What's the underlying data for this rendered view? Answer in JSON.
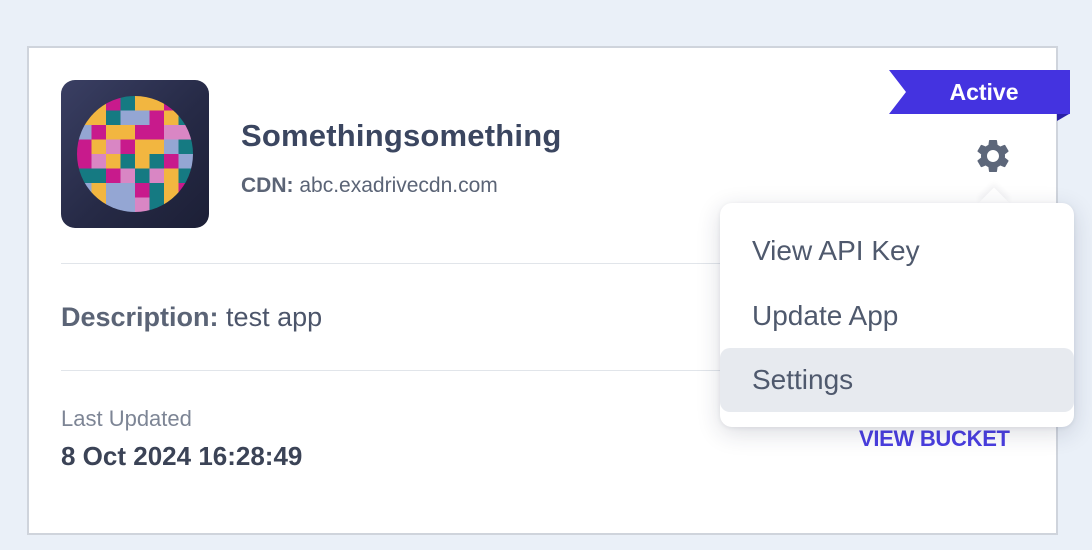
{
  "card": {
    "status_badge": "Active",
    "app_name": "Somethingsomething",
    "cdn_label": "CDN:",
    "cdn_value": "abc.exadrivecdn.com",
    "description_label": "Description:",
    "description_value": "test app",
    "last_updated_label": "Last Updated",
    "last_updated_value": "8 Oct 2024 16:28:49",
    "view_bucket_label": "VIEW BUCKET"
  },
  "menu": {
    "items": [
      {
        "label": "View API Key"
      },
      {
        "label": "Update App"
      },
      {
        "label": "Settings",
        "highlighted": true
      }
    ]
  },
  "icons": {
    "settings": "gear-icon",
    "app": "app-mosaic-icon"
  },
  "colors": {
    "accent": "#4433e0",
    "page_background": "#eaf0f8",
    "mosaic_palette": [
      "#c81a8c",
      "#157a82",
      "#f2b640",
      "#94a6d3",
      "#d986c4"
    ]
  }
}
